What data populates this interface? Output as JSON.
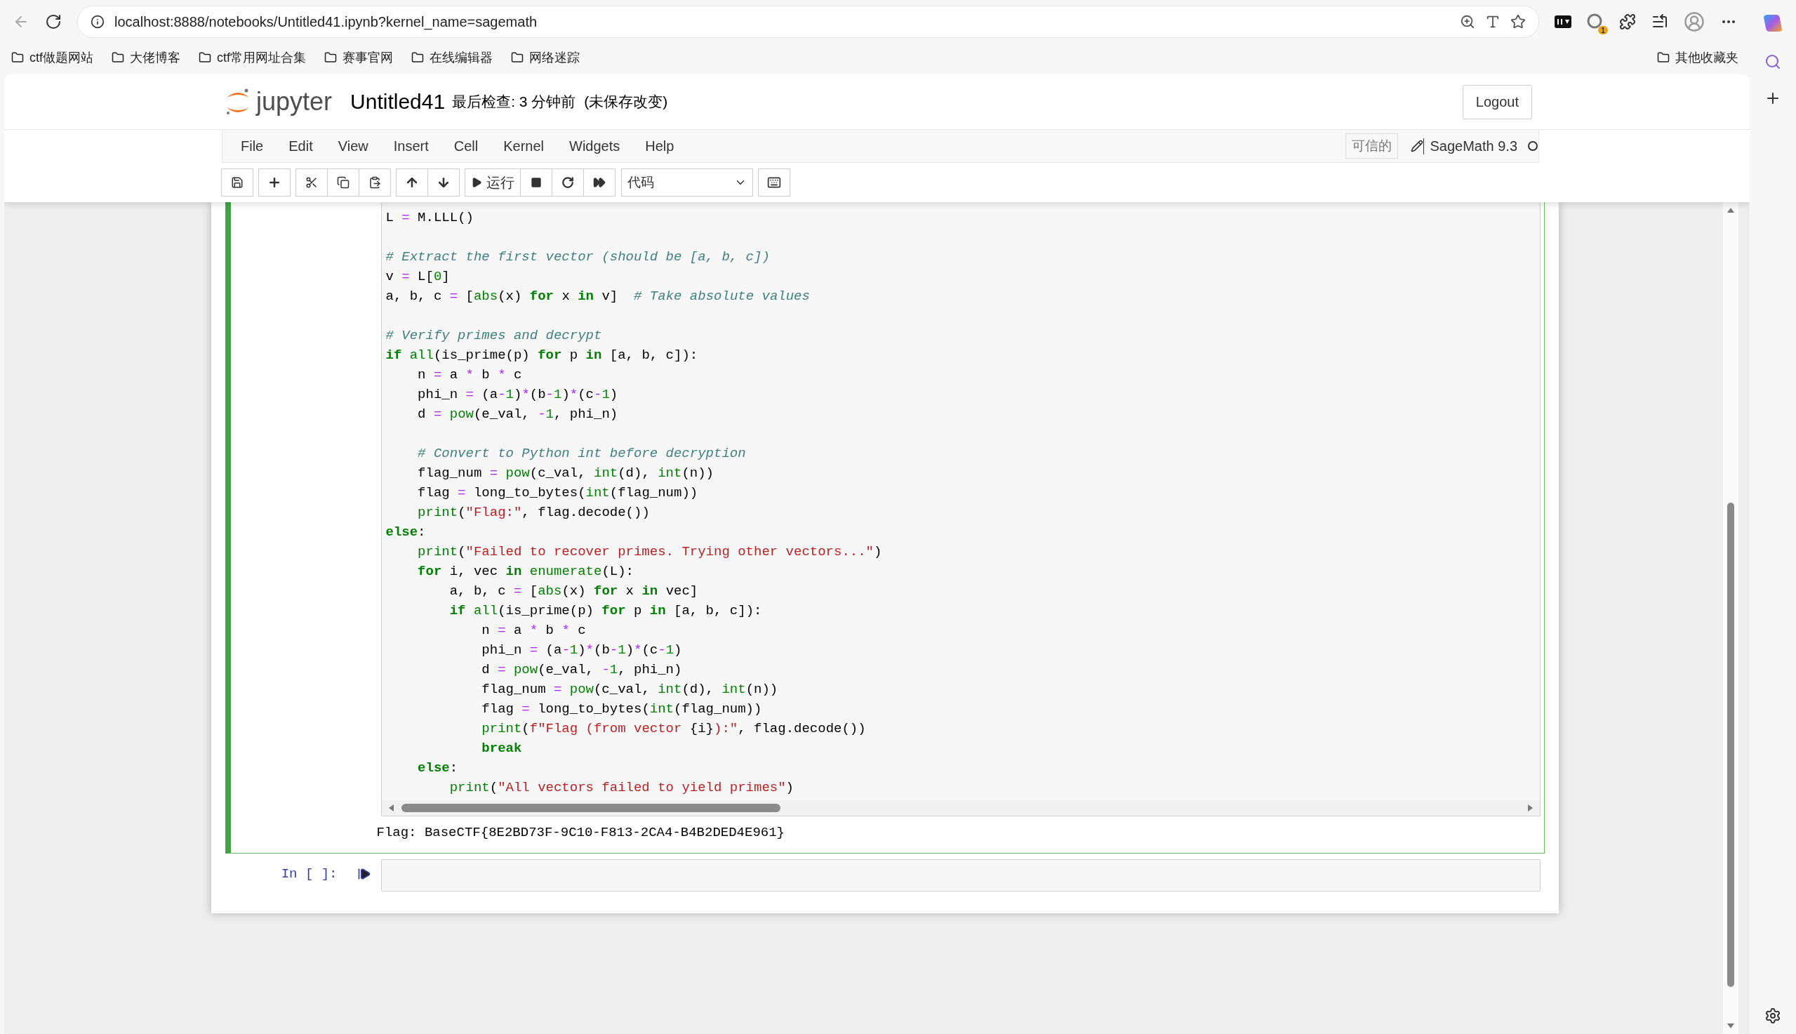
{
  "browser": {
    "url": "localhost:8888/notebooks/Untitled41.ipynb?kernel_name=sagemath",
    "extension_badge": "1",
    "bookmarks": [
      "ctf做题网站",
      "大佬博客",
      "ctf常用网址合集",
      "赛事官网",
      "在线编辑器",
      "网络迷踪"
    ],
    "other_bookmarks": "其他收藏夹"
  },
  "header": {
    "logo_text": "jupyter",
    "title": "Untitled41",
    "checkpoint": "最后检查: 3 分钟前",
    "save_status": "(未保存改变)",
    "logout": "Logout"
  },
  "menu": [
    "File",
    "Edit",
    "View",
    "Insert",
    "Cell",
    "Kernel",
    "Widgets",
    "Help"
  ],
  "trusted": "可信的",
  "kernel_name": "SageMath 9.3",
  "toolbar": {
    "run_label": "运行",
    "cell_type": "代码"
  },
  "cells": [
    {
      "selected": true,
      "lines": [
        {
          "blank_before": false,
          "tokens": [
            {
              "kind": "p",
              "text": "L"
            },
            {
              "kind": "o",
              "text": " ="
            },
            {
              "kind": "p",
              "text": " M.LLL()"
            }
          ]
        },
        {
          "blank_before": true,
          "tokens": [
            {
              "kind": "c",
              "text": "# Extract the first vector (should be [a, b, c])"
            }
          ]
        },
        {
          "blank_before": false,
          "tokens": [
            {
              "kind": "p",
              "text": "v"
            },
            {
              "kind": "o",
              "text": " ="
            },
            {
              "kind": "p",
              "text": " L["
            },
            {
              "kind": "n",
              "text": "0"
            },
            {
              "kind": "p",
              "text": "]"
            }
          ]
        },
        {
          "blank_before": false,
          "tokens": [
            {
              "kind": "p",
              "text": "a, b, c"
            },
            {
              "kind": "o",
              "text": " ="
            },
            {
              "kind": "p",
              "text": " ["
            },
            {
              "kind": "b",
              "text": "abs"
            },
            {
              "kind": "p",
              "text": "(x)"
            },
            {
              "kind": "k",
              "text": " for"
            },
            {
              "kind": "p",
              "text": " x"
            },
            {
              "kind": "k",
              "text": " in"
            },
            {
              "kind": "p",
              "text": " v]"
            },
            {
              "kind": "c",
              "text": "  # Take absolute values"
            }
          ]
        },
        {
          "blank_before": true,
          "tokens": [
            {
              "kind": "c",
              "text": "# Verify primes and decrypt"
            }
          ]
        },
        {
          "blank_before": false,
          "tokens": [
            {
              "kind": "k",
              "text": "if"
            },
            {
              "kind": "b",
              "text": " all"
            },
            {
              "kind": "p",
              "text": "(is_prime(p)"
            },
            {
              "kind": "k",
              "text": " for"
            },
            {
              "kind": "p",
              "text": " p"
            },
            {
              "kind": "k",
              "text": " in"
            },
            {
              "kind": "p",
              "text": " [a, b, c]):"
            }
          ]
        },
        {
          "blank_before": false,
          "tokens": [
            {
              "kind": "p",
              "text": "    n"
            },
            {
              "kind": "o",
              "text": " ="
            },
            {
              "kind": "p",
              "text": " a"
            },
            {
              "kind": "o",
              "text": " *"
            },
            {
              "kind": "p",
              "text": " b"
            },
            {
              "kind": "o",
              "text": " *"
            },
            {
              "kind": "p",
              "text": " c"
            }
          ]
        },
        {
          "blank_before": false,
          "tokens": [
            {
              "kind": "p",
              "text": "    phi_n"
            },
            {
              "kind": "o",
              "text": " ="
            },
            {
              "kind": "p",
              "text": " (a"
            },
            {
              "kind": "o",
              "text": "-"
            },
            {
              "kind": "n",
              "text": "1"
            },
            {
              "kind": "p",
              "text": ")"
            },
            {
              "kind": "o",
              "text": "*"
            },
            {
              "kind": "p",
              "text": "(b"
            },
            {
              "kind": "o",
              "text": "-"
            },
            {
              "kind": "n",
              "text": "1"
            },
            {
              "kind": "p",
              "text": ")"
            },
            {
              "kind": "o",
              "text": "*"
            },
            {
              "kind": "p",
              "text": "(c"
            },
            {
              "kind": "o",
              "text": "-"
            },
            {
              "kind": "n",
              "text": "1"
            },
            {
              "kind": "p",
              "text": ")"
            }
          ]
        },
        {
          "blank_before": false,
          "tokens": [
            {
              "kind": "p",
              "text": "    d"
            },
            {
              "kind": "o",
              "text": " ="
            },
            {
              "kind": "b",
              "text": " pow"
            },
            {
              "kind": "p",
              "text": "(e_val,"
            },
            {
              "kind": "o",
              "text": " -"
            },
            {
              "kind": "n",
              "text": "1"
            },
            {
              "kind": "p",
              "text": ", phi_n)"
            }
          ]
        },
        {
          "blank_before": true,
          "tokens": [
            {
              "kind": "c",
              "text": "    # Convert to Python int before decryption"
            }
          ]
        },
        {
          "blank_before": false,
          "tokens": [
            {
              "kind": "p",
              "text": "    flag_num"
            },
            {
              "kind": "o",
              "text": " ="
            },
            {
              "kind": "b",
              "text": " pow"
            },
            {
              "kind": "p",
              "text": "(c_val,"
            },
            {
              "kind": "b",
              "text": " int"
            },
            {
              "kind": "p",
              "text": "(d),"
            },
            {
              "kind": "b",
              "text": " int"
            },
            {
              "kind": "p",
              "text": "(n))"
            }
          ]
        },
        {
          "blank_before": false,
          "tokens": [
            {
              "kind": "p",
              "text": "    flag"
            },
            {
              "kind": "o",
              "text": " ="
            },
            {
              "kind": "p",
              "text": " long_to_bytes("
            },
            {
              "kind": "b",
              "text": "int"
            },
            {
              "kind": "p",
              "text": "(flag_num))"
            }
          ]
        },
        {
          "blank_before": false,
          "tokens": [
            {
              "kind": "b",
              "text": "    print"
            },
            {
              "kind": "p",
              "text": "("
            },
            {
              "kind": "s",
              "text": "\"Flag:\""
            },
            {
              "kind": "p",
              "text": ", flag.decode())"
            }
          ]
        },
        {
          "blank_before": false,
          "tokens": [
            {
              "kind": "k",
              "text": "else"
            },
            {
              "kind": "p",
              "text": ":"
            }
          ]
        },
        {
          "blank_before": false,
          "tokens": [
            {
              "kind": "b",
              "text": "    print"
            },
            {
              "kind": "p",
              "text": "("
            },
            {
              "kind": "s",
              "text": "\"Failed to recover primes. Trying other vectors...\""
            },
            {
              "kind": "p",
              "text": ")"
            }
          ]
        },
        {
          "blank_before": false,
          "tokens": [
            {
              "kind": "k",
              "text": "    for"
            },
            {
              "kind": "p",
              "text": " i, vec"
            },
            {
              "kind": "k",
              "text": " in"
            },
            {
              "kind": "b",
              "text": " enumerate"
            },
            {
              "kind": "p",
              "text": "(L):"
            }
          ]
        },
        {
          "blank_before": false,
          "tokens": [
            {
              "kind": "p",
              "text": "        a, b, c"
            },
            {
              "kind": "o",
              "text": " ="
            },
            {
              "kind": "p",
              "text": " ["
            },
            {
              "kind": "b",
              "text": "abs"
            },
            {
              "kind": "p",
              "text": "(x)"
            },
            {
              "kind": "k",
              "text": " for"
            },
            {
              "kind": "p",
              "text": " x"
            },
            {
              "kind": "k",
              "text": " in"
            },
            {
              "kind": "p",
              "text": " vec]"
            }
          ]
        },
        {
          "blank_before": false,
          "tokens": [
            {
              "kind": "k",
              "text": "        if"
            },
            {
              "kind": "b",
              "text": " all"
            },
            {
              "kind": "p",
              "text": "(is_prime(p)"
            },
            {
              "kind": "k",
              "text": " for"
            },
            {
              "kind": "p",
              "text": " p"
            },
            {
              "kind": "k",
              "text": " in"
            },
            {
              "kind": "p",
              "text": " [a, b, c]):"
            }
          ]
        },
        {
          "blank_before": false,
          "tokens": [
            {
              "kind": "p",
              "text": "            n"
            },
            {
              "kind": "o",
              "text": " ="
            },
            {
              "kind": "p",
              "text": " a"
            },
            {
              "kind": "o",
              "text": " *"
            },
            {
              "kind": "p",
              "text": " b"
            },
            {
              "kind": "o",
              "text": " *"
            },
            {
              "kind": "p",
              "text": " c"
            }
          ]
        },
        {
          "blank_before": false,
          "tokens": [
            {
              "kind": "p",
              "text": "            phi_n"
            },
            {
              "kind": "o",
              "text": " ="
            },
            {
              "kind": "p",
              "text": " (a"
            },
            {
              "kind": "o",
              "text": "-"
            },
            {
              "kind": "n",
              "text": "1"
            },
            {
              "kind": "p",
              "text": ")"
            },
            {
              "kind": "o",
              "text": "*"
            },
            {
              "kind": "p",
              "text": "(b"
            },
            {
              "kind": "o",
              "text": "-"
            },
            {
              "kind": "n",
              "text": "1"
            },
            {
              "kind": "p",
              "text": ")"
            },
            {
              "kind": "o",
              "text": "*"
            },
            {
              "kind": "p",
              "text": "(c"
            },
            {
              "kind": "o",
              "text": "-"
            },
            {
              "kind": "n",
              "text": "1"
            },
            {
              "kind": "p",
              "text": ")"
            }
          ]
        },
        {
          "blank_before": false,
          "tokens": [
            {
              "kind": "p",
              "text": "            d"
            },
            {
              "kind": "o",
              "text": " ="
            },
            {
              "kind": "b",
              "text": " pow"
            },
            {
              "kind": "p",
              "text": "(e_val,"
            },
            {
              "kind": "o",
              "text": " -"
            },
            {
              "kind": "n",
              "text": "1"
            },
            {
              "kind": "p",
              "text": ", phi_n)"
            }
          ]
        },
        {
          "blank_before": false,
          "tokens": [
            {
              "kind": "p",
              "text": "            flag_num"
            },
            {
              "kind": "o",
              "text": " ="
            },
            {
              "kind": "b",
              "text": " pow"
            },
            {
              "kind": "p",
              "text": "(c_val,"
            },
            {
              "kind": "b",
              "text": " int"
            },
            {
              "kind": "p",
              "text": "(d),"
            },
            {
              "kind": "b",
              "text": " int"
            },
            {
              "kind": "p",
              "text": "(n))"
            }
          ]
        },
        {
          "blank_before": false,
          "tokens": [
            {
              "kind": "p",
              "text": "            flag"
            },
            {
              "kind": "o",
              "text": " ="
            },
            {
              "kind": "p",
              "text": " long_to_bytes("
            },
            {
              "kind": "b",
              "text": "int"
            },
            {
              "kind": "p",
              "text": "(flag_num))"
            }
          ]
        },
        {
          "blank_before": false,
          "tokens": [
            {
              "kind": "b",
              "text": "            print"
            },
            {
              "kind": "p",
              "text": "("
            },
            {
              "kind": "s",
              "text": "f\"Flag (from vector"
            },
            {
              "kind": "p",
              "text": " {i}"
            },
            {
              "kind": "s",
              "text": "):\""
            },
            {
              "kind": "p",
              "text": ", flag.decode())"
            }
          ]
        },
        {
          "blank_before": false,
          "tokens": [
            {
              "kind": "k",
              "text": "            break"
            }
          ]
        },
        {
          "blank_before": false,
          "tokens": [
            {
              "kind": "k",
              "text": "    else"
            },
            {
              "kind": "p",
              "text": ":"
            }
          ]
        },
        {
          "blank_before": false,
          "tokens": [
            {
              "kind": "b",
              "text": "        print"
            },
            {
              "kind": "p",
              "text": "("
            },
            {
              "kind": "s",
              "text": "\"All vectors failed to yield primes\""
            },
            {
              "kind": "p",
              "text": ")"
            }
          ]
        }
      ],
      "output": "Flag: BaseCTF{8E2BD73F-9C10-F813-2CA4-B4B2DED4E961}"
    },
    {
      "selected": false,
      "prompt": "In [ ]:"
    }
  ]
}
